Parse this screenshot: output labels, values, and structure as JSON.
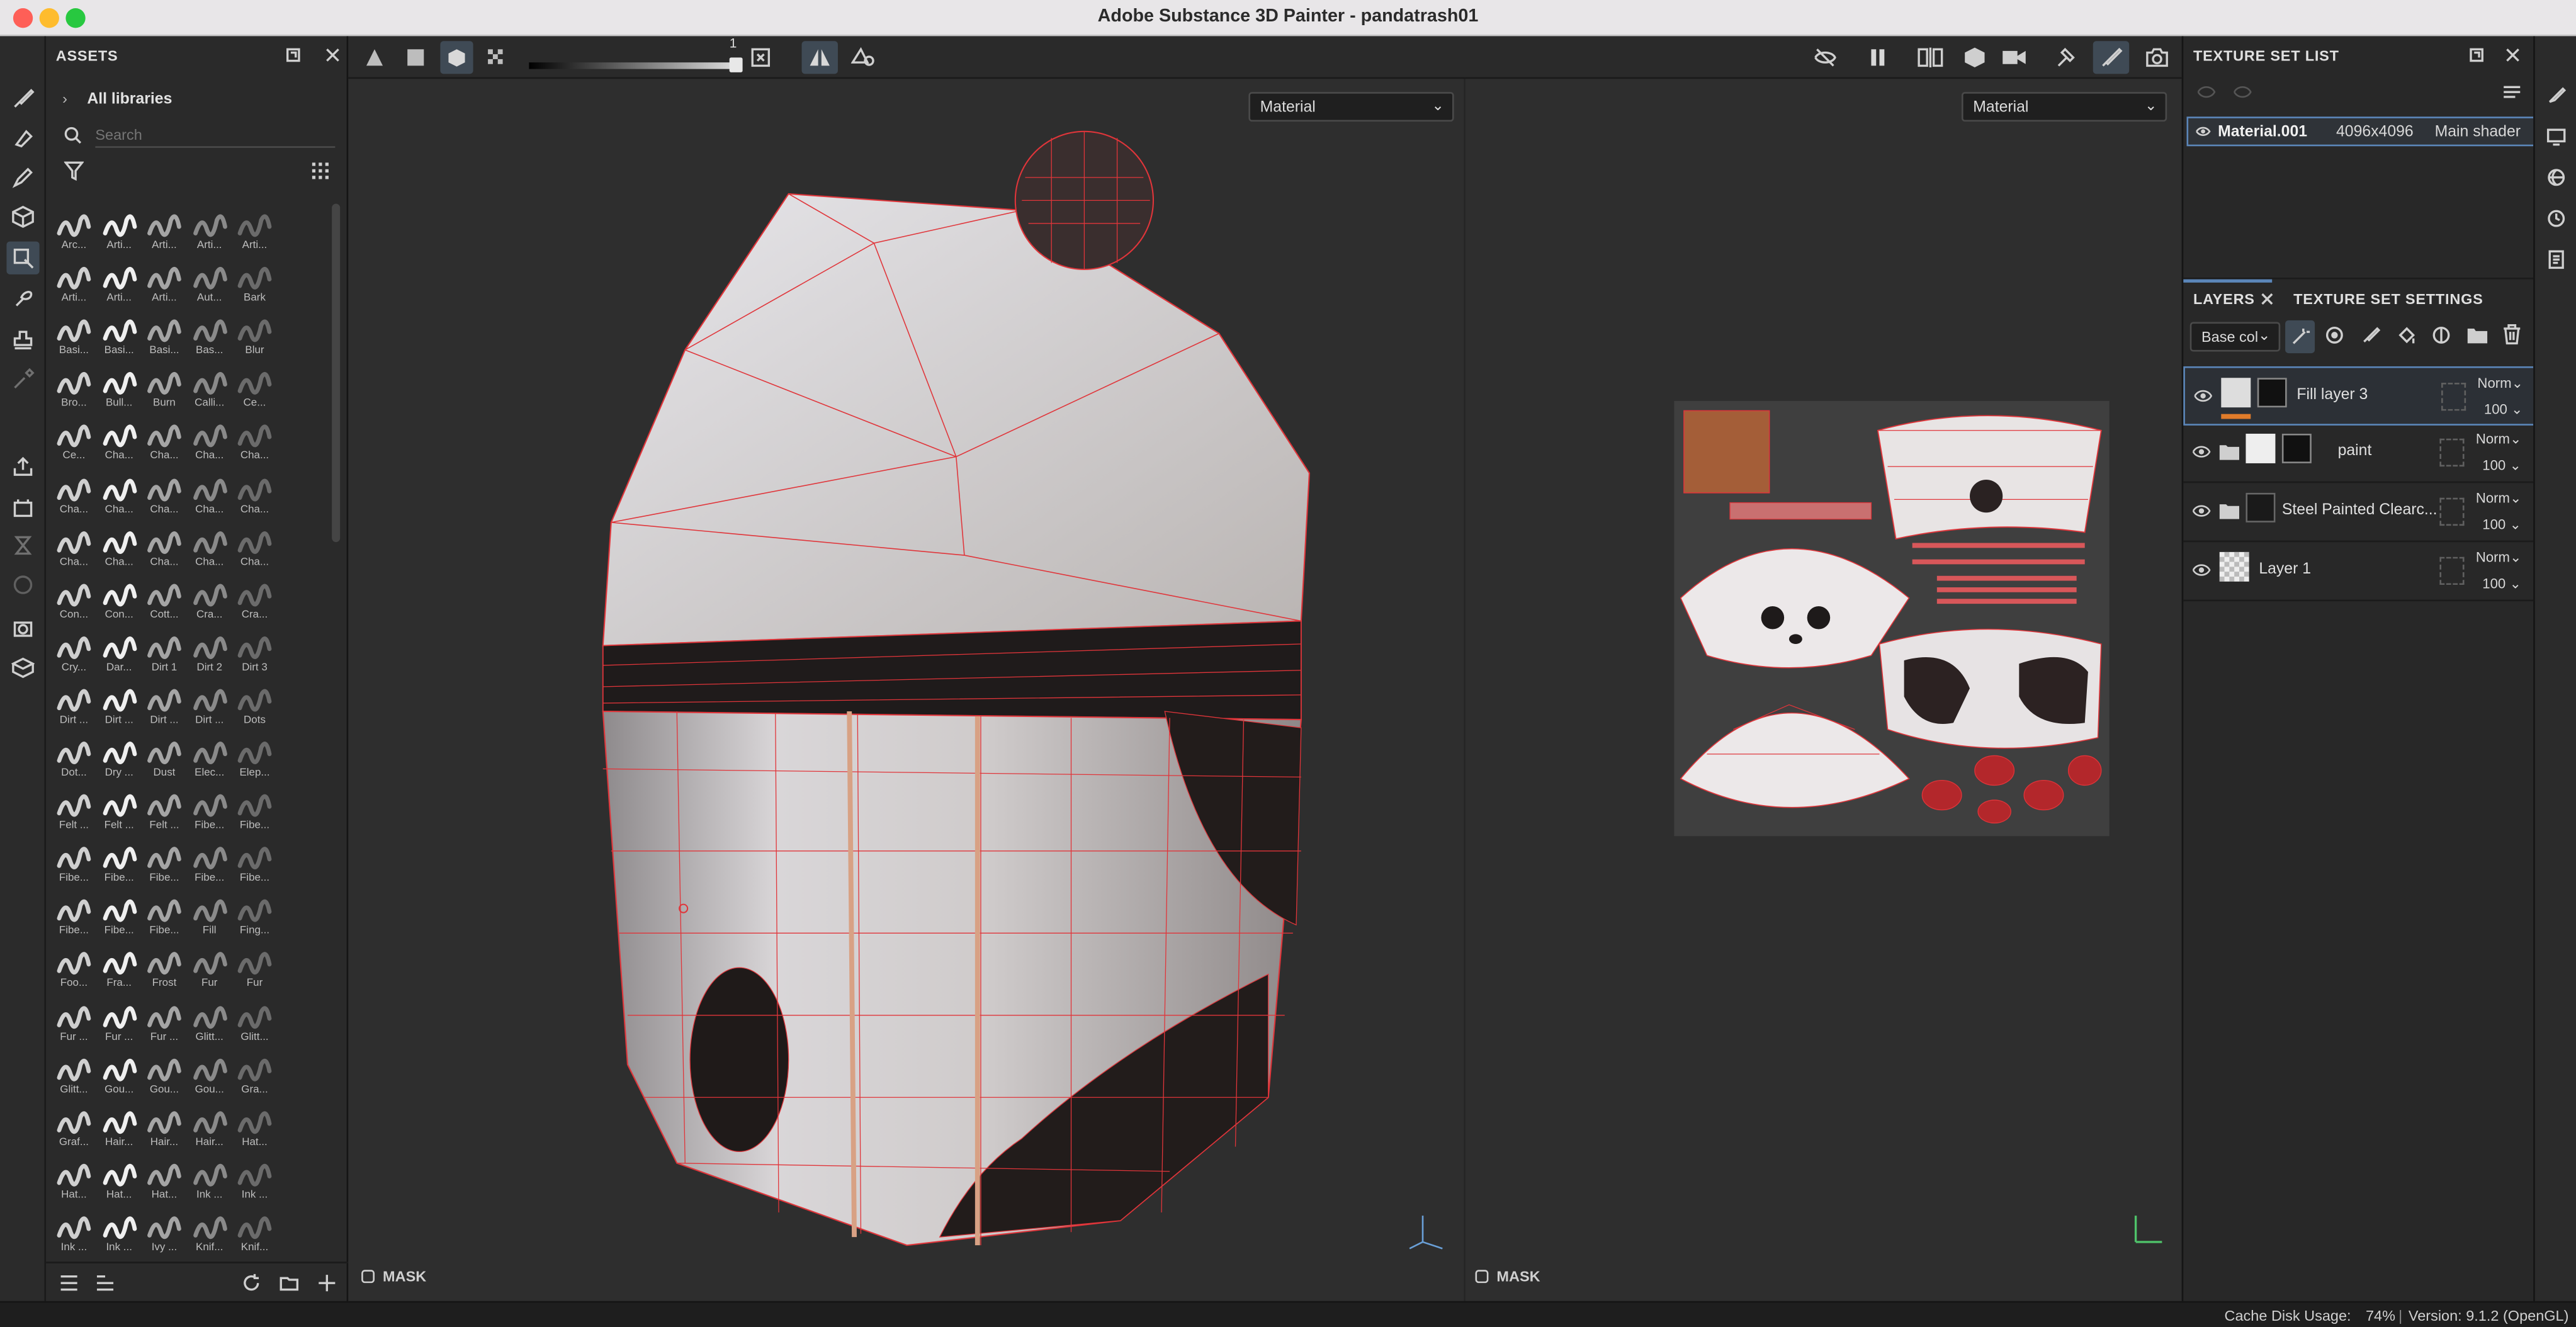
{
  "window": {
    "title": "Adobe Substance 3D Painter - pandatrash01"
  },
  "assets": {
    "title": "ASSETS",
    "library": "All libraries",
    "search_placeholder": "Search",
    "items": [
      "Arc...",
      "Arti...",
      "Arti...",
      "Arti...",
      "Arti...",
      "Arti...",
      "Arti...",
      "Arti...",
      "Aut...",
      "Bark",
      "Basi...",
      "Basi...",
      "Basi...",
      "Bas...",
      "Blur",
      "Bro...",
      "Bull...",
      "Burn",
      "Calli...",
      "Ce...",
      "Ce...",
      "Cha...",
      "Cha...",
      "Cha...",
      "Cha...",
      "Cha...",
      "Cha...",
      "Cha...",
      "Cha...",
      "Cha...",
      "Cha...",
      "Cha...",
      "Cha...",
      "Cha...",
      "Cha...",
      "Con...",
      "Con...",
      "Cott...",
      "Cra...",
      "Cra...",
      "Cry...",
      "Dar...",
      "Dirt 1",
      "Dirt 2",
      "Dirt 3",
      "Dirt ...",
      "Dirt ...",
      "Dirt ...",
      "Dirt ...",
      "Dots",
      "Dot...",
      "Dry ...",
      "Dust",
      "Elec...",
      "Elep...",
      "Felt ...",
      "Felt ...",
      "Felt ...",
      "Fibe...",
      "Fibe...",
      "Fibe...",
      "Fibe...",
      "Fibe...",
      "Fibe...",
      "Fibe...",
      "Fibe...",
      "Fibe...",
      "Fibe...",
      "Fill",
      "Fing...",
      "Foo...",
      "Fra...",
      "Frost",
      "Fur",
      "Fur",
      "Fur ...",
      "Fur ...",
      "Fur ...",
      "Glitt...",
      "Glitt...",
      "Glitt...",
      "Gou...",
      "Gou...",
      "Gou...",
      "Gra...",
      "Graf...",
      "Hair...",
      "Hair...",
      "Hair...",
      "Hat...",
      "Hat...",
      "Hat...",
      "Hat...",
      "Ink ...",
      "Ink ...",
      "Ink ...",
      "Ink ...",
      "Ivy ...",
      "Knif...",
      "Knif..."
    ]
  },
  "toolbar": {
    "slider_value": "1"
  },
  "viewport_left": {
    "channel": "Material",
    "mask_label": "MASK"
  },
  "viewport_right": {
    "channel": "Material",
    "mask_label": "MASK"
  },
  "texture_set_list": {
    "title": "TEXTURE SET LIST",
    "rows": [
      {
        "name": "Material.001",
        "resolution": "4096x4096",
        "shader": "Main shader"
      }
    ]
  },
  "layers_panel": {
    "tabs": [
      "LAYERS",
      "TEXTURE SET SETTINGS"
    ],
    "channel": "Base col",
    "layers": [
      {
        "name": "Fill layer 3",
        "blend": "Norm",
        "opacity": "100"
      },
      {
        "name": "paint",
        "blend": "Norm",
        "opacity": "100"
      },
      {
        "name": "Steel Painted Clearc...",
        "blend": "Norm",
        "opacity": "100"
      },
      {
        "name": "Layer 1",
        "blend": "Norm",
        "opacity": "100"
      }
    ]
  },
  "status": {
    "cache_label": "Cache Disk Usage:",
    "cache_value": "74%",
    "version": "Version: 9.1.2 (OpenGL)"
  },
  "colors": {
    "accent": "#5b86b9",
    "wire": "#e0353a",
    "panel": "#282828"
  }
}
